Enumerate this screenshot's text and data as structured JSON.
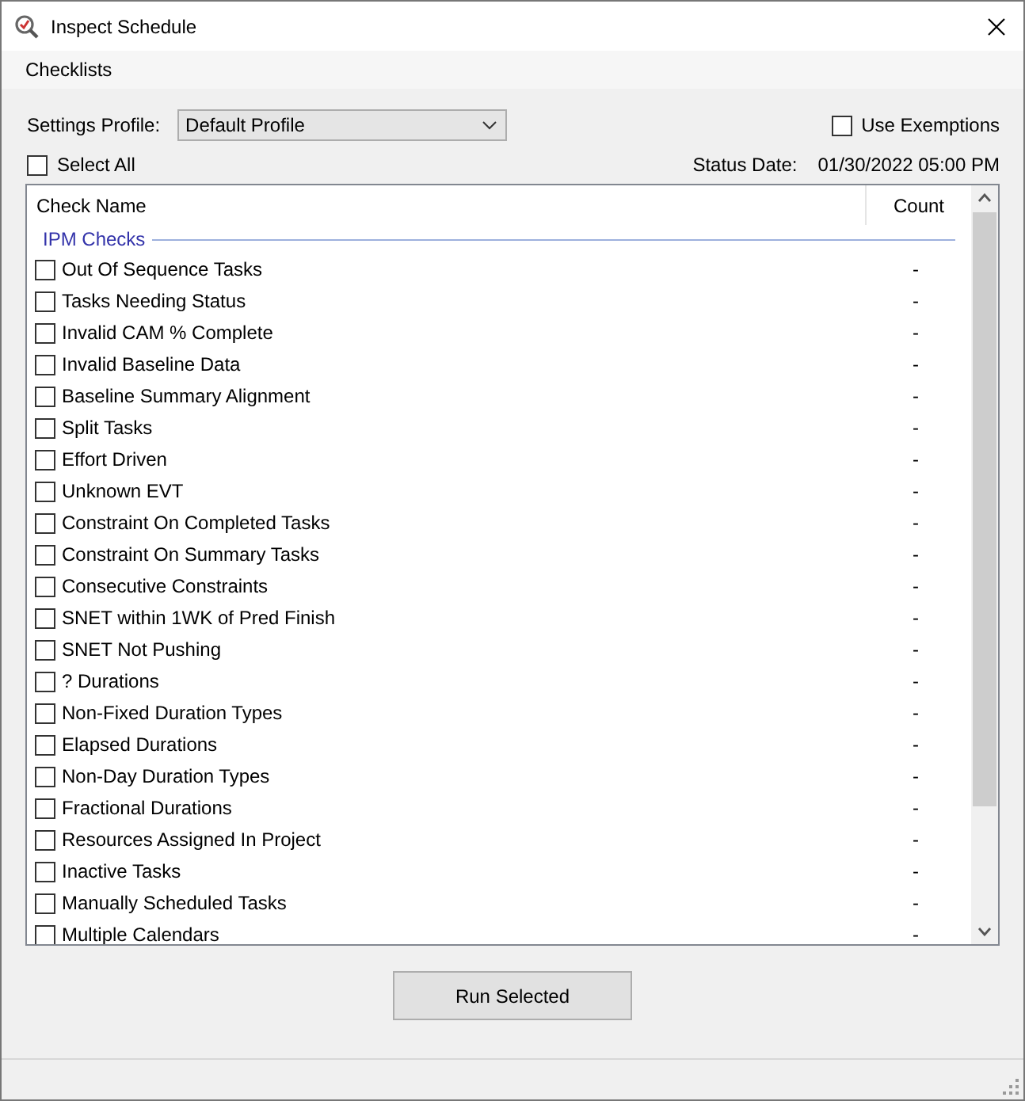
{
  "window": {
    "title": "Inspect Schedule"
  },
  "menu": [
    "Checklists"
  ],
  "settings_profile": {
    "label": "Settings Profile:",
    "value": "Default Profile"
  },
  "use_exemptions": {
    "label": "Use Exemptions",
    "checked": false
  },
  "select_all": {
    "label": "Select All",
    "checked": false
  },
  "status_date": {
    "label": "Status Date:",
    "value": "01/30/2022 05:00 PM"
  },
  "table": {
    "columns": [
      "Check Name",
      "Count"
    ],
    "group": "IPM Checks",
    "rows": [
      {
        "name": "Out Of Sequence Tasks",
        "count": "-",
        "checked": false
      },
      {
        "name": "Tasks Needing Status",
        "count": "-",
        "checked": false
      },
      {
        "name": "Invalid CAM % Complete",
        "count": "-",
        "checked": false
      },
      {
        "name": "Invalid Baseline Data",
        "count": "-",
        "checked": false
      },
      {
        "name": "Baseline Summary Alignment",
        "count": "-",
        "checked": false
      },
      {
        "name": "Split Tasks",
        "count": "-",
        "checked": false
      },
      {
        "name": "Effort Driven",
        "count": "-",
        "checked": false
      },
      {
        "name": "Unknown EVT",
        "count": "-",
        "checked": false
      },
      {
        "name": "Constraint On Completed Tasks",
        "count": "-",
        "checked": false
      },
      {
        "name": "Constraint On Summary Tasks",
        "count": "-",
        "checked": false
      },
      {
        "name": "Consecutive Constraints",
        "count": "-",
        "checked": false
      },
      {
        "name": "SNET within 1WK of Pred Finish",
        "count": "-",
        "checked": false
      },
      {
        "name": "SNET Not Pushing",
        "count": "-",
        "checked": false
      },
      {
        "name": "? Durations",
        "count": "-",
        "checked": false
      },
      {
        "name": "Non-Fixed Duration Types",
        "count": "-",
        "checked": false
      },
      {
        "name": "Elapsed Durations",
        "count": "-",
        "checked": false
      },
      {
        "name": "Non-Day Duration Types",
        "count": "-",
        "checked": false
      },
      {
        "name": "Fractional Durations",
        "count": "-",
        "checked": false
      },
      {
        "name": "Resources Assigned In Project",
        "count": "-",
        "checked": false
      },
      {
        "name": "Inactive Tasks",
        "count": "-",
        "checked": false
      },
      {
        "name": "Manually Scheduled Tasks",
        "count": "-",
        "checked": false
      },
      {
        "name": "Multiple Calendars",
        "count": "-",
        "checked": false
      }
    ]
  },
  "buttons": [
    "Run Selected"
  ]
}
